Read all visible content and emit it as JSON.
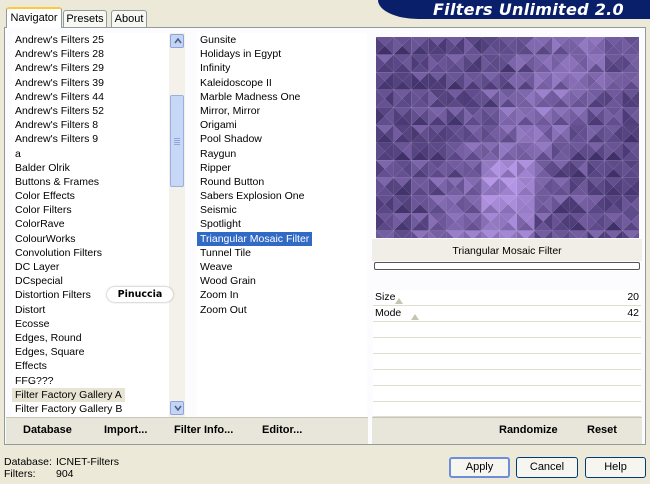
{
  "tabs": [
    {
      "label": "Navigator",
      "active": true
    },
    {
      "label": "Presets",
      "active": false
    },
    {
      "label": "About",
      "active": false
    }
  ],
  "title": "Filters Unlimited 2.0",
  "categories": [
    "Andrew's Filters 25",
    "Andrew's Filters 28",
    "Andrew's Filters 29",
    "Andrew's Filters 39",
    "Andrew's Filters 44",
    "Andrew's Filters 52",
    "Andrew's Filters 8",
    "Andrew's Filters 9",
    "a",
    "Balder Olrik",
    "Buttons & Frames",
    "Color Effects",
    "Color Filters",
    "ColorRave",
    "ColourWorks",
    "Convolution Filters",
    "DC Layer",
    "DCspecial",
    "Distortion Filters",
    "Distort",
    "Ecosse",
    "Edges, Round",
    "Edges, Square",
    "Effects",
    "FFG???",
    "Filter Factory Gallery A",
    "Filter Factory Gallery B"
  ],
  "highlighted_category": "Filter Factory Gallery A",
  "filters": [
    "Gunsite",
    "Holidays in Egypt",
    "Infinity",
    "Kaleidoscope II",
    "Marble Madness One",
    "Mirror, Mirror",
    "Origami",
    "Pool Shadow",
    "Raygun",
    "Ripper",
    "Round Button",
    "Sabers Explosion One",
    "Seismic",
    "Spotlight",
    "Triangular Mosaic Filter",
    "Tunnel Tile",
    "Weave",
    "Wood Grain",
    "Zoom In",
    "Zoom Out"
  ],
  "selected_filter": "Triangular Mosaic Filter",
  "watermark": "Pinuccia",
  "left_buttons": {
    "database": "Database",
    "import": "Import...",
    "filter_info": "Filter Info...",
    "editor": "Editor..."
  },
  "right_buttons": {
    "randomize": "Randomize",
    "reset": "Reset"
  },
  "preview_label": "Triangular Mosaic Filter",
  "params": [
    {
      "label": "Size",
      "value": "20",
      "level": 0.08
    },
    {
      "label": "Mode",
      "value": "42",
      "level": 0.16
    }
  ],
  "footer": {
    "db_label": "Database:",
    "db_value": "ICNET-Filters",
    "filters_label": "Filters:",
    "filters_value": "904"
  },
  "dialog_buttons": {
    "apply": "Apply",
    "cancel": "Cancel",
    "help": "Help"
  },
  "colors": {
    "selection": "#316ac5",
    "banner": "#0a1f6a",
    "mosaic": "#5b4a8a"
  }
}
